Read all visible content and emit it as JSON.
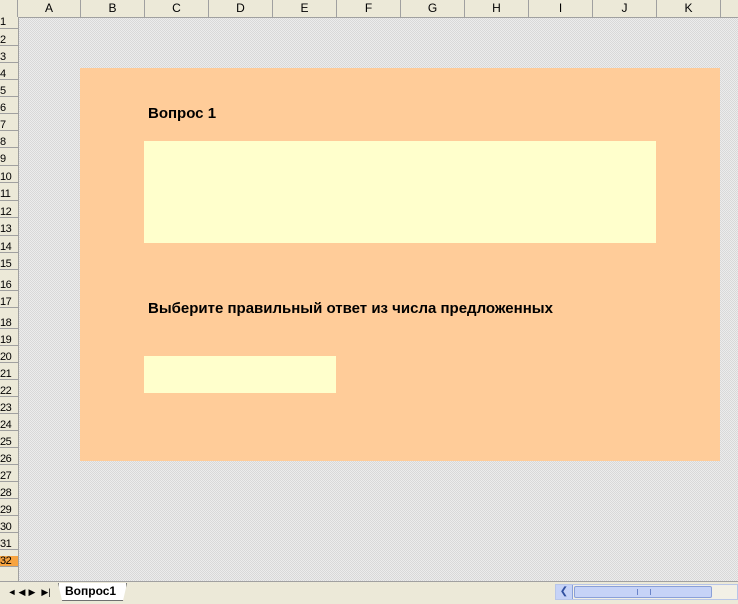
{
  "columns": [
    "A",
    "B",
    "C",
    "D",
    "E",
    "F",
    "G",
    "H",
    "I",
    "J",
    "K"
  ],
  "rows": [
    "1",
    "2",
    "3",
    "4",
    "5",
    "6",
    "7",
    "8",
    "9",
    "10",
    "11",
    "12",
    "13",
    "14",
    "15",
    "16",
    "17",
    "18",
    "19",
    "20",
    "21",
    "22",
    "23",
    "24",
    "25",
    "26",
    "27",
    "28",
    "29",
    "30",
    "31",
    "32"
  ],
  "active_row": "32",
  "question": {
    "title": "Вопрос 1",
    "instruction": "Выберите правильный ответ из числа предложенных"
  },
  "sheet_tabs": [
    "Вопрос1"
  ],
  "nav_buttons": {
    "first": "◄",
    "prev": "◄",
    "next": "►",
    "last": "►|"
  },
  "colors": {
    "panel": "#ffcc99",
    "input_box": "#ffffcc",
    "active_row": "#f7a440"
  }
}
